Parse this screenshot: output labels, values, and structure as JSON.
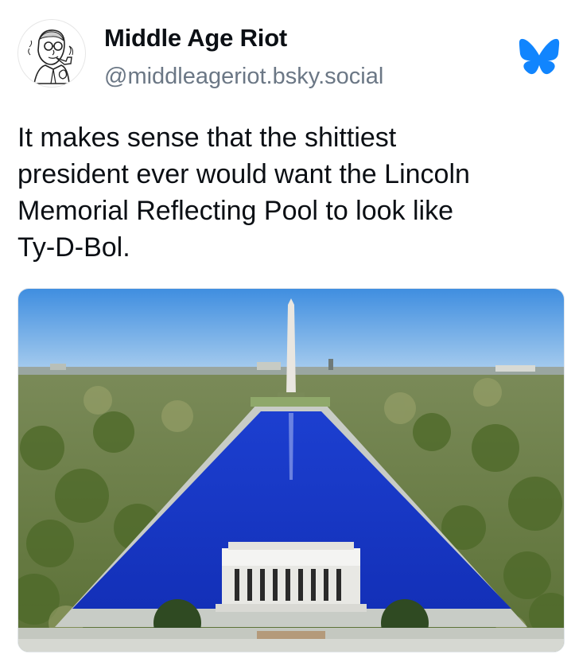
{
  "author": {
    "display_name": "Middle Age Riot",
    "handle": "@middleageriot.bsky.social",
    "avatar_icon": "cartoon-man-pipe-avatar"
  },
  "platform": {
    "logo_icon": "bluesky-butterfly-icon",
    "logo_color": "#1185fe"
  },
  "post": {
    "text_lines": [
      "It makes sense that the shittiest",
      "president ever would want the Lincoln",
      "Memorial Reflecting Pool to look like",
      "Ty-D-Bol."
    ]
  },
  "colors": {
    "pool_blue": "#1538c8",
    "sky_blue": "#5a9fe0",
    "handle_gray": "#6b7785"
  }
}
